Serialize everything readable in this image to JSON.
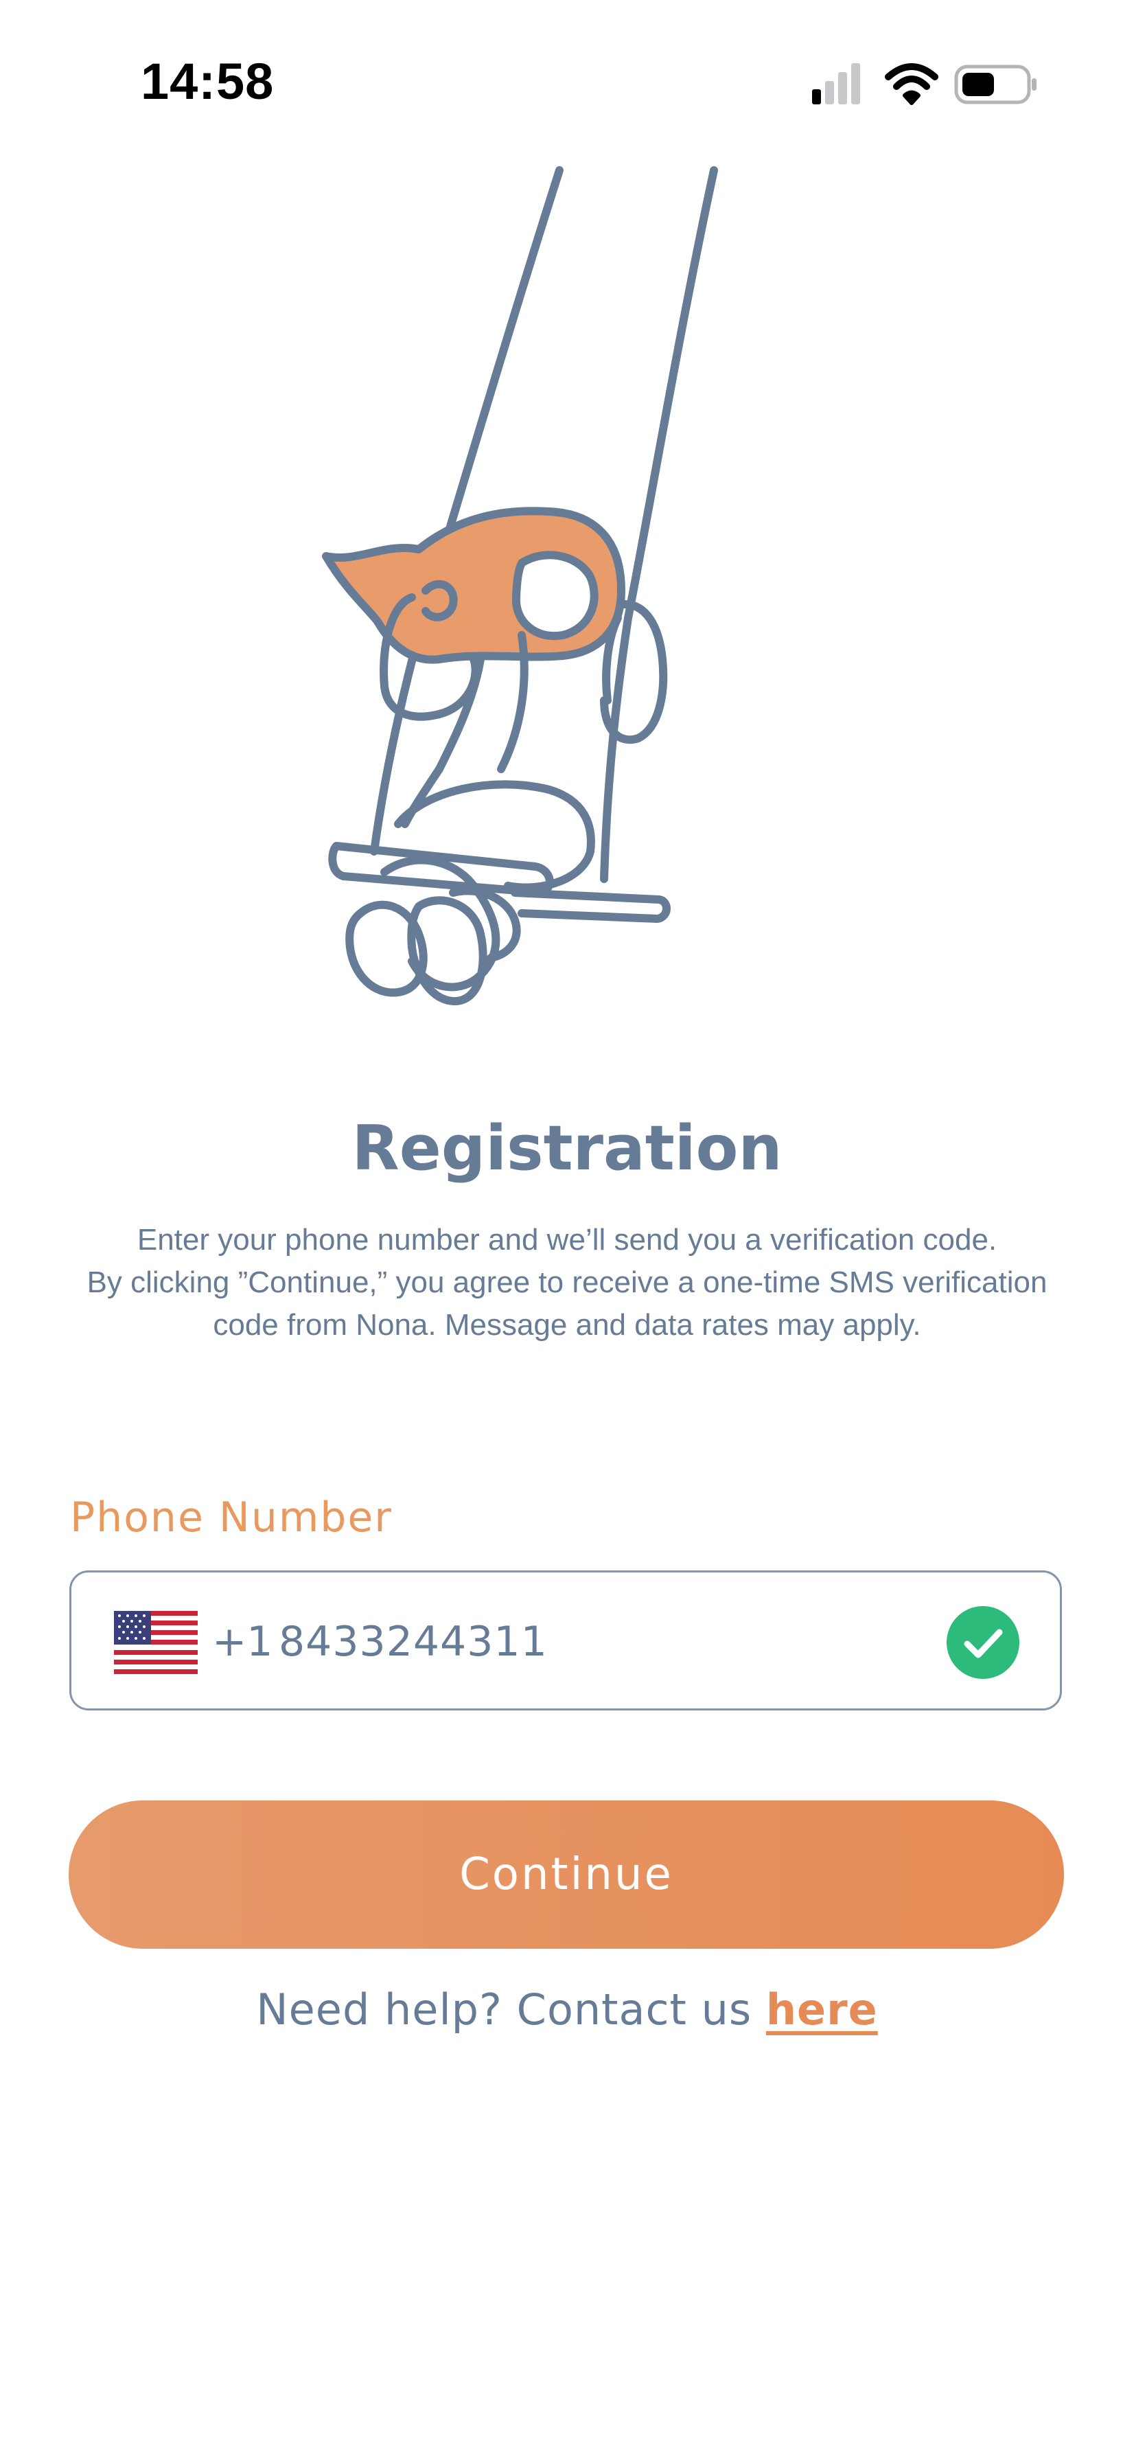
{
  "status_bar": {
    "time": "14:58",
    "icons": [
      "cellular-signal-icon",
      "wifi-icon",
      "battery-icon"
    ]
  },
  "illustration": {
    "icon": "girl-on-swing-illustration"
  },
  "registration": {
    "title": "Registration",
    "description_lines": [
      "Enter your phone number and we’ll send you a verification code.",
      "By clicking ”Continue,” you agree to receive a one-time SMS verification",
      "code from Nona. Message and data rates may apply."
    ]
  },
  "phone": {
    "label": "Phone Number",
    "country_flag": "us-flag-icon",
    "dial_code": "+1",
    "value": "8433244311",
    "valid_icon": "check-circle-icon"
  },
  "actions": {
    "continue_label": "Continue",
    "help_text": "Need help? Contact us ",
    "help_link": "here"
  },
  "colors": {
    "text": "#667b95",
    "accent": "#e68b55",
    "label": "#e8995f",
    "success": "#2dbb7b"
  }
}
